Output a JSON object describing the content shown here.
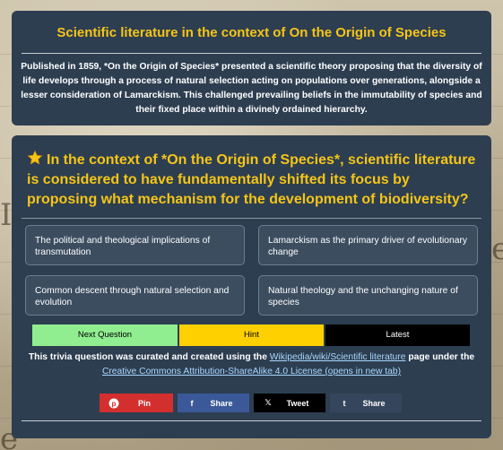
{
  "intro": {
    "title": "Scientific literature in the context of On the Origin of Species",
    "text": "Published in 1859, *On the Origin of Species* presented a scientific theory proposing that the diversity of life develops through a process of natural selection acting on populations over generations, alongside a lesser consideration of Lamarckism. This challenged prevailing beliefs in the immutability of species and their fixed place within a divinely ordained hierarchy."
  },
  "question": {
    "icon": "star-icon",
    "text": "In the context of *On the Origin of Species*, scientific literature is considered to have fundamentally shifted its focus by proposing what mechanism for the development of biodiversity?"
  },
  "answers": [
    "The political and theological implications of transmutation",
    "Lamarckism as the primary driver of evolutionary change",
    "Common descent through natural selection and evolution",
    "Natural theology and the unchanging nature of species"
  ],
  "buttons": {
    "next": "Next Question",
    "hint": "Hint",
    "latest": "Latest"
  },
  "credit": {
    "prefix": "This trivia question was curated and created using the ",
    "source_link": "Wikipedia/wiki/Scientific literature",
    "middle": " page under the ",
    "license_link": "Creative Commons Attribution-ShareAlike 4.0 License (opens in new tab)"
  },
  "share": {
    "pin": "Pin",
    "facebook": "Share",
    "tweet": "Tweet",
    "tumblr": "Share"
  },
  "colors": {
    "card": "#2d3e50",
    "accent": "#f5c518",
    "next": "#90ee90",
    "hint": "#ffd000",
    "latest": "#000000"
  }
}
